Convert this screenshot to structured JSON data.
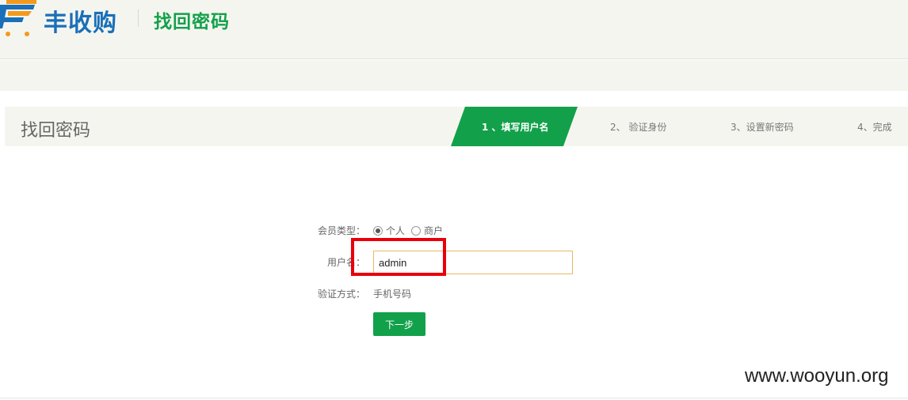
{
  "header": {
    "brand": "丰收购",
    "page_heading": "找回密码"
  },
  "steps": {
    "title": "找回密码",
    "items": [
      {
        "label": "1 、填写用户名"
      },
      {
        "label": "2、 验证身份"
      },
      {
        "label": "3、设置新密码"
      },
      {
        "label": "4、完成"
      }
    ]
  },
  "form": {
    "member_type_label": "会员类型：",
    "member_types": [
      {
        "label": "个人",
        "checked": true
      },
      {
        "label": "商户",
        "checked": false
      }
    ],
    "username_label": "用户名：",
    "username_value": "admin",
    "verify_label": "验证方式：",
    "verify_value": "手机号码",
    "next_button": "下一步"
  },
  "watermark": "www.wooyun.org",
  "colors": {
    "brand_blue": "#1a6fb8",
    "accent_green": "#12a14a",
    "logo_orange": "#f39a1e",
    "highlight_red": "#e8000b"
  }
}
